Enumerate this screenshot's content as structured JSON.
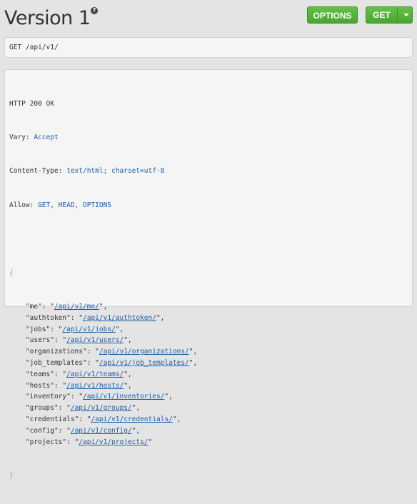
{
  "page": {
    "title": "Version 1",
    "help_icon": "?"
  },
  "buttons": {
    "options": "OPTIONS",
    "get": "GET"
  },
  "request": {
    "method": "GET",
    "path": "/api/v1/"
  },
  "response": {
    "status": "HTTP 200 OK",
    "headers": [
      {
        "key": "Vary:",
        "value": "Accept"
      },
      {
        "key": "Content-Type:",
        "value": "text/html; charset=utf-8"
      },
      {
        "key": "Allow:",
        "value": "GET, HEAD, OPTIONS"
      }
    ],
    "open_brace": "{",
    "close_brace": "}",
    "entries": [
      {
        "key": "me",
        "url": "/api/v1/me/"
      },
      {
        "key": "authtoken",
        "url": "/api/v1/authtoken/"
      },
      {
        "key": "jobs",
        "url": "/api/v1/jobs/"
      },
      {
        "key": "users",
        "url": "/api/v1/users/"
      },
      {
        "key": "organizations",
        "url": "/api/v1/organizations/"
      },
      {
        "key": "job_templates",
        "url": "/api/v1/job_templates/"
      },
      {
        "key": "teams",
        "url": "/api/v1/teams/"
      },
      {
        "key": "hosts",
        "url": "/api/v1/hosts/"
      },
      {
        "key": "inventory",
        "url": "/api/v1/inventories/"
      },
      {
        "key": "groups",
        "url": "/api/v1/groups/"
      },
      {
        "key": "credentials",
        "url": "/api/v1/credentials/"
      },
      {
        "key": "config",
        "url": "/api/v1/config/"
      },
      {
        "key": "projects",
        "url": "/api/v1/projects/"
      }
    ]
  }
}
